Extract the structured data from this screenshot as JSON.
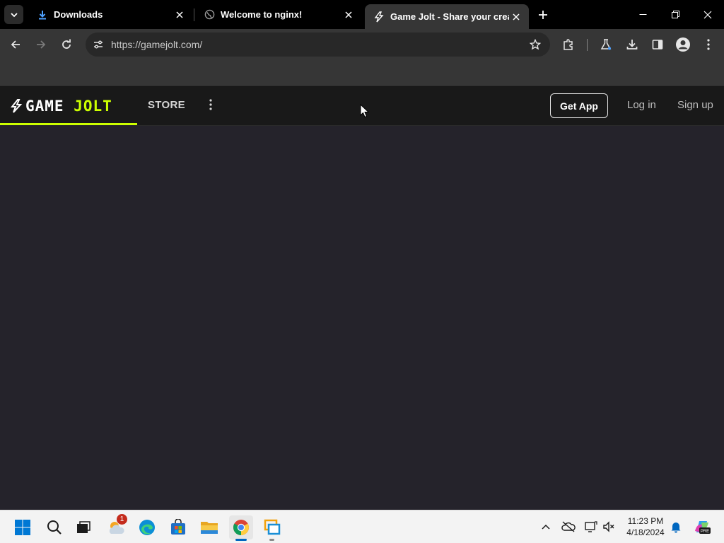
{
  "browser": {
    "tabs": [
      {
        "title": "Downloads",
        "icon": "download-icon",
        "active": false
      },
      {
        "title": "Welcome to nginx!",
        "icon": "globe-icon",
        "active": false
      },
      {
        "title": "Game Jolt - Share your creations",
        "icon": "gamejolt-bolt-icon",
        "active": true
      }
    ],
    "url": "https://gamejolt.com/"
  },
  "site": {
    "logo_text_left": "GAME ",
    "logo_text_right": "JOLT",
    "nav_store": "STORE",
    "get_app": "Get App",
    "login": "Log in",
    "signup": "Sign up",
    "accent_color": "#ccff00",
    "background_color": "#25232b"
  },
  "taskbar": {
    "weather_badge": "1",
    "time": "11:23 PM",
    "date": "4/18/2024"
  }
}
